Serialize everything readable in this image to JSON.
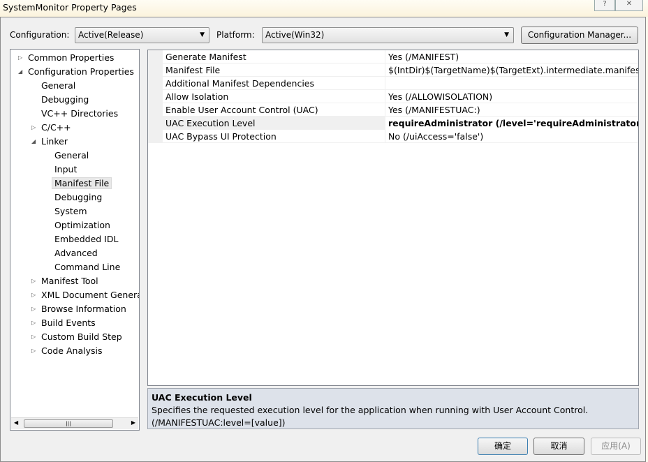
{
  "window": {
    "title": "SystemMonitor Property Pages",
    "help_icon": "?",
    "close_icon": "✕"
  },
  "toolbar": {
    "configuration_label": "Configuration:",
    "configuration_value": "Active(Release)",
    "platform_label": "Platform:",
    "platform_value": "Active(Win32)",
    "config_manager": "Configuration Manager..."
  },
  "tree": [
    {
      "label": "Common Properties",
      "level": 0,
      "tw": "▷"
    },
    {
      "label": "Configuration Properties",
      "level": 0,
      "tw": "◢"
    },
    {
      "label": "General",
      "level": 1
    },
    {
      "label": "Debugging",
      "level": 1
    },
    {
      "label": "VC++ Directories",
      "level": 1
    },
    {
      "label": "C/C++",
      "level": 1,
      "tw": "▷"
    },
    {
      "label": "Linker",
      "level": 1,
      "tw": "◢"
    },
    {
      "label": "General",
      "level": 2
    },
    {
      "label": "Input",
      "level": 2
    },
    {
      "label": "Manifest File",
      "level": 2,
      "selected": true
    },
    {
      "label": "Debugging",
      "level": 2
    },
    {
      "label": "System",
      "level": 2
    },
    {
      "label": "Optimization",
      "level": 2
    },
    {
      "label": "Embedded IDL",
      "level": 2
    },
    {
      "label": "Advanced",
      "level": 2
    },
    {
      "label": "Command Line",
      "level": 2
    },
    {
      "label": "Manifest Tool",
      "level": 1,
      "tw": "▷"
    },
    {
      "label": "XML Document Generator",
      "level": 1,
      "tw": "▷"
    },
    {
      "label": "Browse Information",
      "level": 1,
      "tw": "▷"
    },
    {
      "label": "Build Events",
      "level": 1,
      "tw": "▷"
    },
    {
      "label": "Custom Build Step",
      "level": 1,
      "tw": "▷"
    },
    {
      "label": "Code Analysis",
      "level": 1,
      "tw": "▷"
    }
  ],
  "properties": [
    {
      "name": "Generate Manifest",
      "value": "Yes (/MANIFEST)"
    },
    {
      "name": "Manifest File",
      "value": "$(IntDir)$(TargetName)$(TargetExt).intermediate.manifest"
    },
    {
      "name": "Additional Manifest Dependencies",
      "value": ""
    },
    {
      "name": "Allow Isolation",
      "value": "Yes (/ALLOWISOLATION)"
    },
    {
      "name": "Enable User Account Control (UAC)",
      "value": "Yes (/MANIFESTUAC:)"
    },
    {
      "name": "UAC Execution Level",
      "value": "requireAdministrator (/level='requireAdministrator')",
      "selected": true
    },
    {
      "name": "UAC Bypass UI Protection",
      "value": "No (/uiAccess='false')"
    }
  ],
  "description": {
    "title": "UAC Execution Level",
    "text": "Specifies the requested execution level for the application when running with User Account Control.",
    "switch": "(/MANIFESTUAC:level=[value])"
  },
  "buttons": {
    "ok": "确定",
    "cancel": "取消",
    "apply": "应用(A)"
  }
}
